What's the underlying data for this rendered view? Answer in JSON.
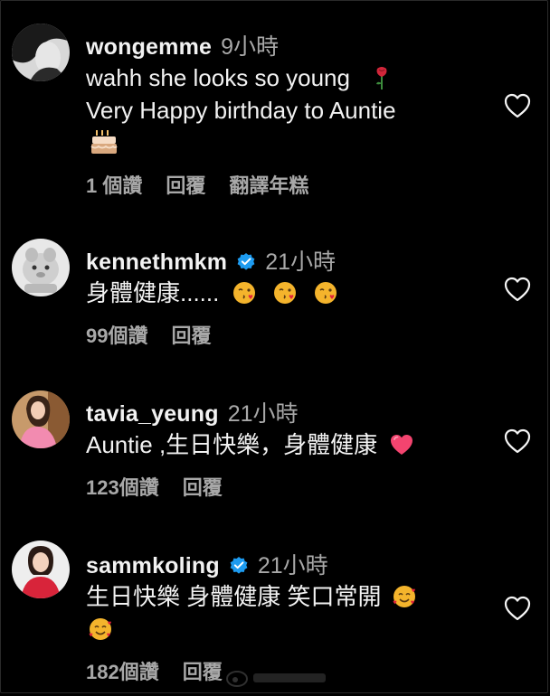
{
  "comments": [
    {
      "username": "wongemme",
      "time": "9小時",
      "verified": false,
      "text_line1": "wahh she looks so young",
      "text_line2": "Very Happy birthday to Auntie",
      "likes": "1 個讚",
      "reply": "回覆",
      "translate": "翻譯年糕",
      "emojis": [
        "rose-emoji",
        "birthday-cake-emoji"
      ]
    },
    {
      "username": "kennethmkm",
      "time": "21小時",
      "verified": true,
      "text": "身體健康......",
      "likes": "99個讚",
      "reply": "回覆",
      "emojis": [
        "face-blowing-kiss-emoji",
        "face-blowing-kiss-emoji",
        "face-blowing-kiss-emoji"
      ]
    },
    {
      "username": "tavia_yeung",
      "time": "21小時",
      "verified": false,
      "text": "Auntie ,生日快樂，身體健康",
      "likes": "123個讚",
      "reply": "回覆",
      "emojis": [
        "pink-heart-emoji"
      ]
    },
    {
      "username": "sammkoling",
      "time": "21小時",
      "verified": true,
      "text": "生日快樂 身體健康 笑口常開",
      "likes": "182個讚",
      "reply": "回覆",
      "emojis": [
        "smiling-face-with-hearts-emoji",
        "smiling-face-with-hearts-emoji"
      ]
    }
  ],
  "colors": {
    "background": "#000000",
    "primary_text": "#f2f2f2",
    "secondary_text": "#a8a8a8",
    "verified_blue": "#1d9bf0",
    "heart_outline": "#f5f5f5"
  }
}
